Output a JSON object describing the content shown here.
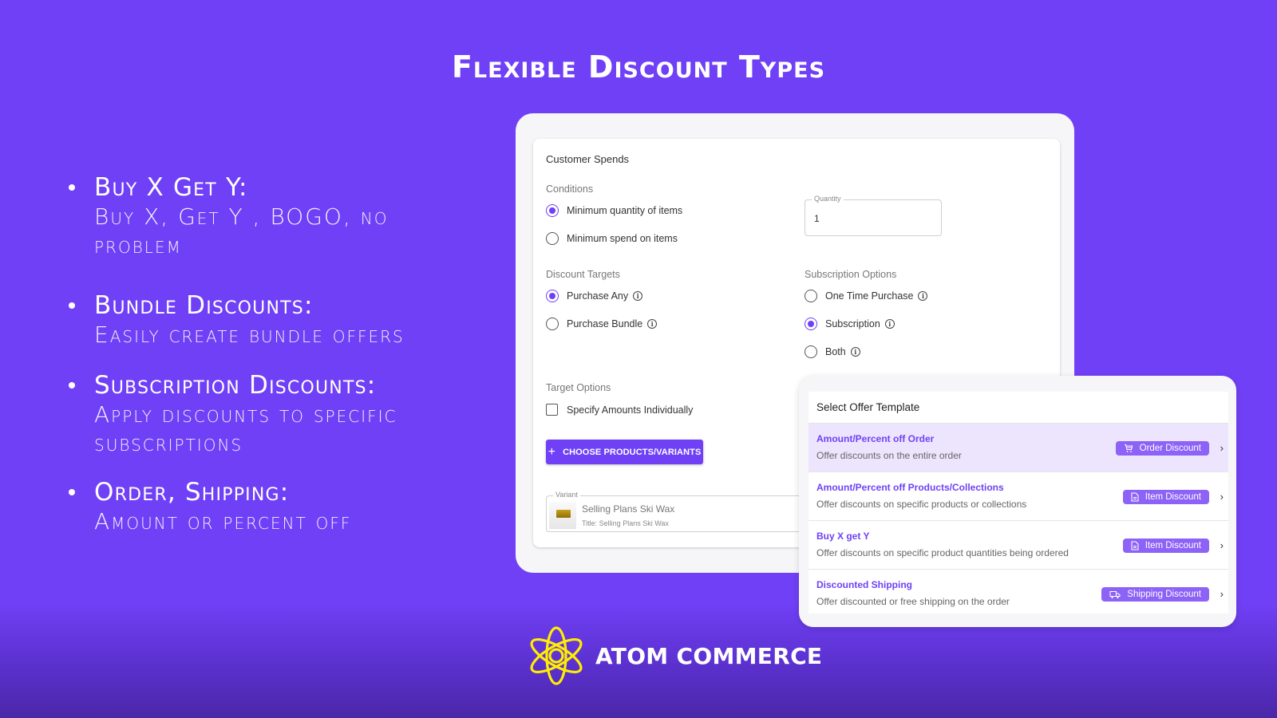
{
  "slide": {
    "title": "Flexible Discount Types"
  },
  "bullets": [
    {
      "heading": "Buy X Get Y:",
      "text": "Buy X, Get Y , BOGO, no problem"
    },
    {
      "heading": "Bundle Discounts:",
      "text": "Easily create bundle offers"
    },
    {
      "heading": "Subscription Discounts:",
      "text": "Apply discounts to specific subscriptions"
    },
    {
      "heading": "Order, Shipping:",
      "text": "Amount or percent off"
    }
  ],
  "form": {
    "title": "Customer Spends",
    "conditions": {
      "label": "Conditions",
      "options": [
        {
          "label": "Minimum quantity of items",
          "selected": true
        },
        {
          "label": "Minimum spend on items",
          "selected": false
        }
      ]
    },
    "quantity": {
      "label": "Quantity",
      "value": "1"
    },
    "discount_targets": {
      "label": "Discount Targets",
      "options": [
        {
          "label": "Purchase Any",
          "selected": true,
          "info_icon": "info-icon"
        },
        {
          "label": "Purchase Bundle",
          "selected": false,
          "info_icon": "info-icon"
        }
      ]
    },
    "subscription_options": {
      "label": "Subscription Options",
      "options": [
        {
          "label": "One Time Purchase",
          "selected": false,
          "info_icon": "info-icon"
        },
        {
          "label": "Subscription",
          "selected": true,
          "info_icon": "info-icon"
        },
        {
          "label": "Both",
          "selected": false,
          "info_icon": "info-icon"
        }
      ]
    },
    "target_options": {
      "label": "Target Options",
      "checkbox_label": "Specify Amounts Individually",
      "checked": false
    },
    "choose_button": {
      "icon": "plus-icon",
      "label": "CHOOSE PRODUCTS/VARIANTS"
    },
    "variant": {
      "label": "Variant",
      "name": "Selling Plans Ski Wax",
      "subtitle": "Title: Selling Plans Ski Wax"
    }
  },
  "offer_template": {
    "title": "Select Offer Template",
    "items": [
      {
        "name": "Amount/Percent off Order",
        "description": "Offer discounts on the entire order",
        "badge": "Order Discount",
        "badge_icon": "cart-icon",
        "active": true
      },
      {
        "name": "Amount/Percent off Products/Collections",
        "description": "Offer discounts on specific products or collections",
        "badge": "Item Discount",
        "badge_icon": "document-icon",
        "active": false
      },
      {
        "name": "Buy X get Y",
        "description": "Offer discounts on specific product quantities being ordered",
        "badge": "Item Discount",
        "badge_icon": "document-icon",
        "active": false
      },
      {
        "name": "Discounted Shipping",
        "description": "Offer discounted or free shipping on the order",
        "badge": "Shipping Discount",
        "badge_icon": "truck-icon",
        "active": false
      }
    ],
    "chevron": "›"
  },
  "brand": {
    "name": "ATOM COMMERCE",
    "logo_icon": "atom-icon"
  },
  "colors": {
    "background": "#7040f6",
    "accent": "#7040f6",
    "badge": "#8c62f7",
    "active_row": "#ece5fd",
    "logo": "#ffee00"
  }
}
